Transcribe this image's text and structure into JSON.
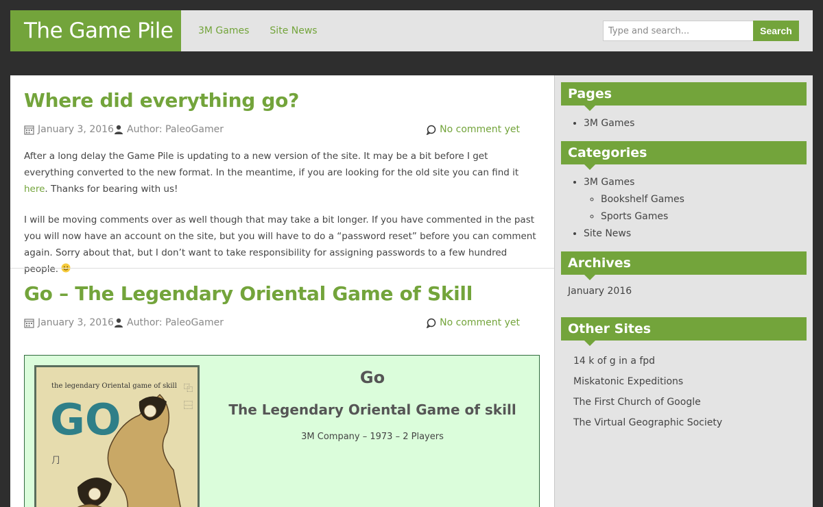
{
  "site": {
    "logo": "The Game Pile",
    "nav": [
      "3M Games",
      "Site News"
    ],
    "search": {
      "placeholder": "Type and search...",
      "button": "Search"
    }
  },
  "posts": [
    {
      "title": "Where did everything go?",
      "date": "January 3, 2016",
      "author": "Author: PaleoGamer",
      "comments": "No comment yet",
      "p1_a": "After a long delay the Game Pile is updating to a new version of the site. It may be a bit before I get everything converted to the new format. In the meantime, if you are looking for the old site you can find it ",
      "p1_link": "here",
      "p1_b": ". Thanks for bearing with us!",
      "p2": "I will be moving comments over as well though that may take a bit longer. If you have commented in the past you will now have an account on the site, but you will have to do a “password reset” before you can comment again. Sorry about that, but I don’t want to take responsibility for assigning passwords to a few hundred people. "
    },
    {
      "title": "Go – The Legendary Oriental Game of Skill",
      "date": "January 3, 2016",
      "author": "Author: PaleoGamer",
      "comments": "No comment yet",
      "game": {
        "title": "Go",
        "subtitle": "The Legendary Oriental Game of skill",
        "info": "3M Company – 1973 – 2 Players",
        "cover_text": "the legendary Oriental game of skill",
        "cover_logo": "GO"
      }
    }
  ],
  "sidebar": {
    "pages": {
      "title": "Pages",
      "items": [
        "3M Games"
      ]
    },
    "categories": {
      "title": "Categories",
      "items": [
        "3M Games",
        "Site News"
      ],
      "subitems": [
        "Bookshelf Games",
        "Sports Games"
      ]
    },
    "archives": {
      "title": "Archives",
      "items": [
        "January 2016"
      ]
    },
    "other_sites": {
      "title": "Other Sites",
      "items": [
        "14 k of g in a fpd",
        "Miskatonic Expeditions",
        "The First Church of Google",
        "The Virtual Geographic Society"
      ]
    }
  },
  "colors": {
    "accent": "#73a43b",
    "header_bg": "#e4e4e4",
    "page_bg": "#2e2e2e",
    "game_box_bg": "#dbfddb"
  },
  "icons": [
    "calendar-icon",
    "user-icon",
    "comment-icon",
    "smiley-icon"
  ]
}
